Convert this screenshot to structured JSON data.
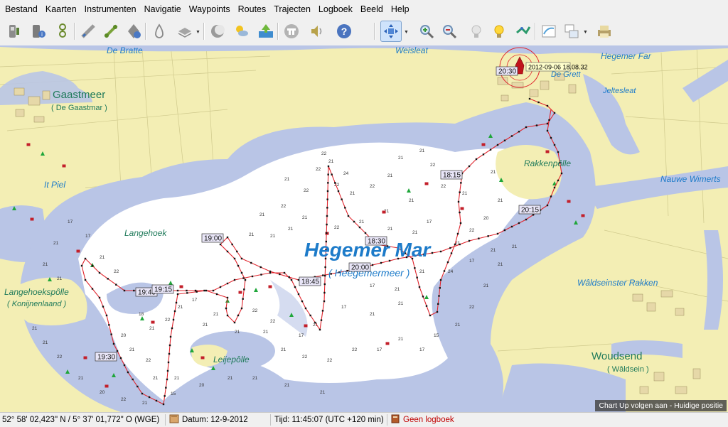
{
  "menu": [
    "Bestand",
    "Kaarten",
    "Instrumenten",
    "Navigatie",
    "Waypoints",
    "Routes",
    "Trajecten",
    "Logboek",
    "Beeld",
    "Help"
  ],
  "toolbar": {
    "icons": [
      "instruments-icon",
      "info-instruments-icon",
      "gps-icon",
      "ruler-icon",
      "route-icon",
      "waypoint-info-icon",
      "anchor-drop-icon",
      "layers-icon",
      "moon-icon",
      "weather-icon",
      "chart-download-icon",
      "tide-icon",
      "sound-icon",
      "help-icon",
      "follow-mode-icon",
      "zoom-in-icon",
      "zoom-out-icon",
      "light-off-icon",
      "light-on-icon",
      "trail-icon",
      "chart-view-icon",
      "chart-select-icon",
      "print-icon"
    ]
  },
  "map": {
    "lake_name": "Hegemer Mar",
    "lake_subtitle": "( Heegemermeer )",
    "places": [
      {
        "id": "gaastmeer",
        "text": "Gaastmeer",
        "type": "town"
      },
      {
        "id": "gaastmeer-sub",
        "text": "( De Gaastmar )",
        "type": "townsub"
      },
      {
        "id": "woudsend",
        "text": "Woudsend",
        "type": "town"
      },
      {
        "id": "woudsend-sub",
        "text": "( Wâldsein )",
        "type": "townsub"
      },
      {
        "id": "de-bratte",
        "text": "De Bratte",
        "type": "water"
      },
      {
        "id": "weisleat",
        "text": "Weisleat",
        "type": "water"
      },
      {
        "id": "hegemer-far",
        "text": "Hegemer Far",
        "type": "water"
      },
      {
        "id": "de-grett",
        "text": "De Grett",
        "type": "water"
      },
      {
        "id": "jeltesleat",
        "text": "Jeltesleat",
        "type": "water"
      },
      {
        "id": "it-piel",
        "text": "It Piel",
        "type": "water"
      },
      {
        "id": "rakkenpolle",
        "text": "Rakkenpôlle",
        "type": "land"
      },
      {
        "id": "nauwe-wimerts",
        "text": "Nauwe Wimerts",
        "type": "water"
      },
      {
        "id": "langehoek",
        "text": "Langehoek",
        "type": "land"
      },
      {
        "id": "langehoekspolle",
        "text": "Langehoekspôlle",
        "type": "land"
      },
      {
        "id": "konijnenlaand",
        "text": "( Konijnenlaand )",
        "type": "landsub"
      },
      {
        "id": "leijepolle",
        "text": "Leijepôlle",
        "type": "land"
      },
      {
        "id": "waldseinster-rakken",
        "text": "Wâldseinster Rakken",
        "type": "water"
      }
    ],
    "time_labels": [
      "20:30",
      "18:15",
      "20:15",
      "19:00",
      "18:30",
      "20:00",
      "18:45",
      "19:45",
      "19:15",
      "19:30"
    ],
    "boat_tooltip": "2012-09-06 18.08.32",
    "depths": [
      "22",
      "21",
      "22",
      "24",
      "22",
      "21",
      "22",
      "21",
      "22",
      "21",
      "21",
      "21",
      "22",
      "22",
      "21",
      "21",
      "21",
      "22",
      "21",
      "22",
      "21",
      "21",
      "21",
      "21",
      "17",
      "21",
      "21",
      "21",
      "20",
      "22",
      "21",
      "21",
      "17",
      "21",
      "21",
      "21",
      "21",
      "17",
      "21",
      "17",
      "22",
      "22",
      "17",
      "21",
      "22",
      "21",
      "18",
      "20",
      "21",
      "22",
      "21",
      "21",
      "21",
      "21",
      "21",
      "21",
      "21",
      "22",
      "22",
      "22",
      "17",
      "21",
      "17",
      "15",
      "21",
      "22",
      "21",
      "21",
      "17",
      "24",
      "21",
      "21",
      "21",
      "22",
      "21",
      "17",
      "17",
      "21",
      "21",
      "21",
      "21",
      "21",
      "22",
      "21",
      "20",
      "22",
      "21",
      "15",
      "20",
      "21",
      "21",
      "21",
      "21"
    ],
    "overlay_status": "Chart Up volgen aan - Huidige positie"
  },
  "status": {
    "position": "52° 58' 02,423\" N / 5° 37' 01,772\" O (WGE)",
    "datum": "Datum: 12-9-2012",
    "tijd": "Tijd: 11:45:07 (UTC +120 min)",
    "logbook": "Geen logboek"
  },
  "colors": {
    "land": "#f3eeb4",
    "shallow_water": "#b9c5e6",
    "deep_water": "#ffffff",
    "track": "#e0242c",
    "label_water": "#1d7bc9",
    "label_land": "#1f7a5a",
    "logbook_text": "#c00000"
  }
}
